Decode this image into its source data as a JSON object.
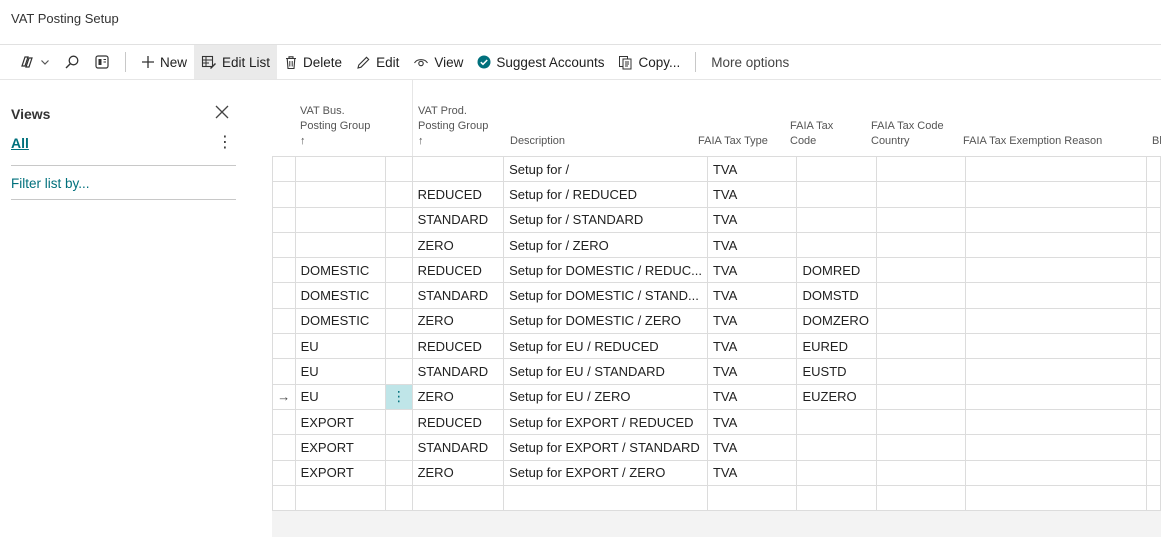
{
  "page": {
    "title": "VAT Posting Setup"
  },
  "toolbar": {
    "new_label": "New",
    "edit_list_label": "Edit List",
    "delete_label": "Delete",
    "edit_label": "Edit",
    "view_label": "View",
    "suggest_accounts_label": "Suggest Accounts",
    "copy_label": "Copy...",
    "more_options_label": "More options"
  },
  "views": {
    "title": "Views",
    "all_label": "All",
    "more_glyph": "⋮",
    "filter_label": "Filter list by..."
  },
  "grid": {
    "columns": {
      "bus_group_line1": "VAT Bus.",
      "bus_group_line2": "Posting Group",
      "prod_group_line1": "VAT Prod.",
      "prod_group_line2": "Posting Group",
      "sort_glyph": "↑",
      "description": "Description",
      "faia_tax_type": "FAIA Tax Type",
      "faia_tax_code_line1": "FAIA Tax",
      "faia_tax_code_line2": "Code",
      "faia_country_line1": "FAIA Tax Code",
      "faia_country_line2": "Country",
      "faia_exemption": "FAIA Tax Exemption Reason",
      "cut_off": "Bl"
    },
    "current_row_glyph": "→",
    "row_menu_glyph": "⋮",
    "rows": [
      {
        "marker": "",
        "bus": "",
        "prod": "",
        "desc": "Setup for  /",
        "type": "TVA",
        "code": "",
        "country": "",
        "exemption": ""
      },
      {
        "marker": "",
        "bus": "",
        "prod": "REDUCED",
        "desc": "Setup for  / REDUCED",
        "type": "TVA",
        "code": "",
        "country": "",
        "exemption": ""
      },
      {
        "marker": "",
        "bus": "",
        "prod": "STANDARD",
        "desc": "Setup for  / STANDARD",
        "type": "TVA",
        "code": "",
        "country": "",
        "exemption": ""
      },
      {
        "marker": "",
        "bus": "",
        "prod": "ZERO",
        "desc": "Setup for  / ZERO",
        "type": "TVA",
        "code": "",
        "country": "",
        "exemption": ""
      },
      {
        "marker": "",
        "bus": "DOMESTIC",
        "prod": "REDUCED",
        "desc": "Setup for DOMESTIC / REDUC...",
        "type": "TVA",
        "code": "DOMRED",
        "country": "",
        "exemption": ""
      },
      {
        "marker": "",
        "bus": "DOMESTIC",
        "prod": "STANDARD",
        "desc": "Setup for DOMESTIC / STAND...",
        "type": "TVA",
        "code": "DOMSTD",
        "country": "",
        "exemption": ""
      },
      {
        "marker": "",
        "bus": "DOMESTIC",
        "prod": "ZERO",
        "desc": "Setup for DOMESTIC / ZERO",
        "type": "TVA",
        "code": "DOMZERO",
        "country": "",
        "exemption": ""
      },
      {
        "marker": "",
        "bus": "EU",
        "prod": "REDUCED",
        "desc": "Setup for EU / REDUCED",
        "type": "TVA",
        "code": "EURED",
        "country": "",
        "exemption": ""
      },
      {
        "marker": "",
        "bus": "EU",
        "prod": "STANDARD",
        "desc": "Setup for EU / STANDARD",
        "type": "TVA",
        "code": "EUSTD",
        "country": "",
        "exemption": ""
      },
      {
        "marker": "→",
        "bus": "EU",
        "prod": "ZERO",
        "desc": "Setup for EU / ZERO",
        "type": "TVA",
        "code": "EUZERO",
        "country": "",
        "exemption": "",
        "selected": true
      },
      {
        "marker": "",
        "bus": "EXPORT",
        "prod": "REDUCED",
        "desc": "Setup for EXPORT / REDUCED",
        "type": "TVA",
        "code": "",
        "country": "",
        "exemption": ""
      },
      {
        "marker": "",
        "bus": "EXPORT",
        "prod": "STANDARD",
        "desc": "Setup for EXPORT / STANDARD",
        "type": "TVA",
        "code": "",
        "country": "",
        "exemption": ""
      },
      {
        "marker": "",
        "bus": "EXPORT",
        "prod": "ZERO",
        "desc": "Setup for EXPORT / ZERO",
        "type": "TVA",
        "code": "",
        "country": "",
        "exemption": ""
      },
      {
        "marker": "",
        "bus": "",
        "prod": "",
        "desc": "",
        "type": "",
        "code": "",
        "country": "",
        "exemption": ""
      }
    ]
  }
}
